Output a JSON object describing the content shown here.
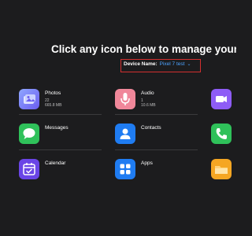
{
  "header": {
    "title": "Click any icon below to manage your device"
  },
  "device": {
    "label": "Device Name:",
    "value": "Pixel 7 test",
    "chevron": "chevron-down-icon"
  },
  "colors": {
    "accent": "#4da3ff",
    "highlight_border": "#d32f2f",
    "background": "#1c1c1e"
  },
  "categories": [
    {
      "label": "Photos",
      "count": "22",
      "size": "665.8 MB",
      "icon": "photos-icon"
    },
    {
      "label": "Audio",
      "count": "1",
      "size": "10.6 MB",
      "icon": "microphone-icon"
    },
    {
      "label": "Video",
      "icon": "video-icon"
    },
    {
      "label": "Messages",
      "icon": "messages-icon"
    },
    {
      "label": "Contacts",
      "icon": "contacts-icon"
    },
    {
      "label": "Phone",
      "icon": "phone-icon"
    },
    {
      "label": "Calendar",
      "icon": "calendar-icon"
    },
    {
      "label": "Apps",
      "icon": "apps-icon"
    },
    {
      "label": "Files",
      "icon": "folder-icon"
    }
  ]
}
